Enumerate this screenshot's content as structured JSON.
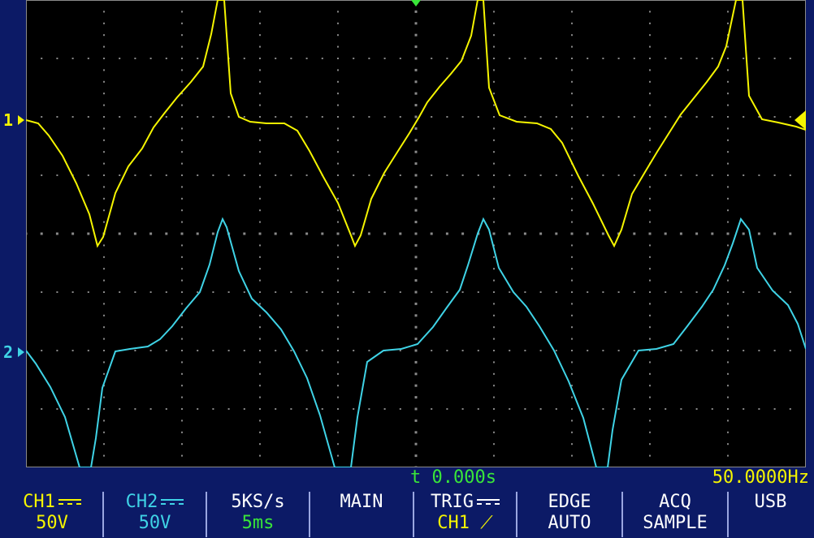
{
  "colors": {
    "ch1": "#f5f500",
    "ch2": "#3fd3e6",
    "grid": "#8a8a8a",
    "trigger_time": "#39e639",
    "background": "#0c1a66"
  },
  "markers": {
    "ch1_label": "1",
    "ch2_label": "2"
  },
  "readouts": {
    "time": "t 0.000s",
    "frequency": "50.0000Hz"
  },
  "menu": {
    "ch1": {
      "label": "CH1",
      "value": "50V",
      "coupling_icon": "dc-coupling-icon"
    },
    "ch2": {
      "label": "CH2",
      "value": "50V",
      "coupling_icon": "dc-coupling-icon"
    },
    "timebase": {
      "sample_rate": "5KS/s",
      "value": "5ms"
    },
    "main": {
      "label": "MAIN"
    },
    "trig": {
      "label": "TRIG",
      "value": "CH1 ⟋",
      "icon": "rising-edge-icon"
    },
    "edge": {
      "label": "EDGE",
      "value": "AUTO"
    },
    "acq": {
      "label": "ACQ",
      "value": "SAMPLE"
    },
    "usb": {
      "label": "USB"
    }
  }
}
